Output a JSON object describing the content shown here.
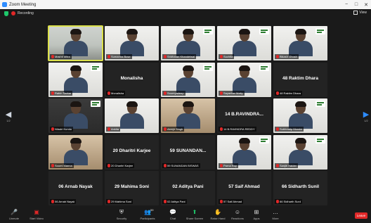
{
  "window": {
    "title": "Zoom Meeting",
    "controls": [
      "−",
      "□",
      "✕"
    ]
  },
  "status": {
    "recording_label": "Recording",
    "view_label": "View"
  },
  "pager": {
    "left_num": "1/2",
    "right_num": "1/2"
  },
  "tiles": [
    {
      "kind": "video",
      "bg": "bg-light",
      "label": "Mashti Mitra",
      "active": true,
      "brand": false
    },
    {
      "kind": "video",
      "bg": "bg-white",
      "label": "Sumantra Bose",
      "brand": false
    },
    {
      "kind": "video",
      "bg": "bg-white",
      "label": "Sridharan Khandelwal",
      "brand": true
    },
    {
      "kind": "video",
      "bg": "bg-white",
      "label": "Suchita",
      "brand": true
    },
    {
      "kind": "video",
      "bg": "bg-white",
      "label": "Bikash Ghosh",
      "brand": true
    },
    {
      "kind": "video",
      "bg": "bg-white",
      "label": "Rabin Sarkar",
      "brand": true
    },
    {
      "kind": "name",
      "name": "Monalisha",
      "label": "Monalisha"
    },
    {
      "kind": "video",
      "bg": "bg-white",
      "label": "Soumyadeep",
      "brand": true
    },
    {
      "kind": "video",
      "bg": "bg-white",
      "label": "Sayantan Maity",
      "brand": true
    },
    {
      "kind": "name",
      "name": "48 Raktim Dhara",
      "label": "48 Raktim Dhara"
    },
    {
      "kind": "video",
      "bg": "bg-dark",
      "label": "Niladri Kundu",
      "brand": true
    },
    {
      "kind": "video",
      "bg": "bg-white",
      "label": "Ankita",
      "brand": false
    },
    {
      "kind": "video",
      "bg": "bg-warm",
      "label": "Abhijit Singh",
      "brand": false
    },
    {
      "kind": "name",
      "name": "14 B.RAVINDRA...",
      "label": "14 B.RAVINDRA REDDY"
    },
    {
      "kind": "video",
      "bg": "bg-white",
      "label": "Subhradip Mondal",
      "brand": true
    },
    {
      "kind": "video",
      "bg": "bg-warm",
      "label": "Soumi Manna",
      "brand": false
    },
    {
      "kind": "name",
      "name": "20 Dharitri Karjee",
      "label": "20 Dharitri Karjee"
    },
    {
      "kind": "name",
      "name": "59 SUNANDAN...",
      "label": "59 SUNANDAN BISWAS"
    },
    {
      "kind": "video",
      "bg": "bg-white",
      "label": "Parna Roy",
      "brand": true
    },
    {
      "kind": "video",
      "bg": "bg-white",
      "label": "Sanjib Halder",
      "brand": true
    },
    {
      "kind": "name",
      "name": "06 Arnab Nayak",
      "label": "06 Arnab Nayak"
    },
    {
      "kind": "name",
      "name": "29 Mahima Soni",
      "label": "29 Mahima Soni"
    },
    {
      "kind": "name",
      "name": "02 Aditya Pani",
      "label": "02 Aditya Pani"
    },
    {
      "kind": "name",
      "name": "57 Saif Ahmad",
      "label": "57 Saif Ahmad"
    },
    {
      "kind": "name",
      "name": "66 Sidharth Sunil",
      "label": "66 Sidharth Sunil"
    }
  ],
  "toolbar": {
    "unmute": "Unmute",
    "start_video": "Start Video",
    "security": "Security",
    "participants": "Participants",
    "participants_count": "59",
    "chat": "Chat",
    "share_screen": "Share Screen",
    "raise_hand": "Raise Hand",
    "reactions": "Reactions",
    "apps": "Apps",
    "more": "More",
    "end": "Leave"
  }
}
